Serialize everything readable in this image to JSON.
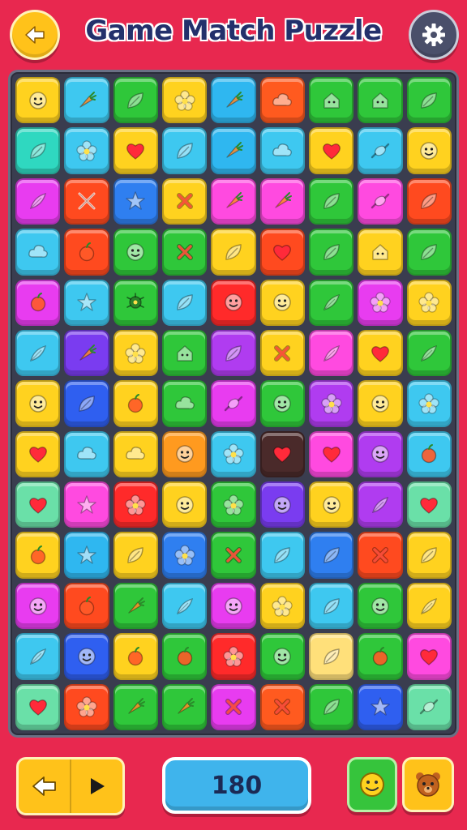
{
  "header": {
    "title": "Game Match Puzzle",
    "back_icon": "arrow-left-icon",
    "settings_icon": "gear-icon"
  },
  "board": {
    "rows": 13,
    "cols": 9,
    "tiles": [
      [
        "#ffd21f",
        "#3ec8f0",
        "#2fc73a",
        "#ffd21f",
        "#2fb7f0",
        "#ff5a1f",
        "#2fc73a",
        "#2fc73a",
        "#2fc73a"
      ],
      [
        "#2fd8c0",
        "#3ec8f0",
        "#ffd21f",
        "#3ec8f0",
        "#2fb7f0",
        "#3ec8f0",
        "#ffd21f",
        "#3ec8f0",
        "#ffd21f"
      ],
      [
        "#e83cf0",
        "#ff4a1f",
        "#2f7ff0",
        "#ffd21f",
        "#ff4ae0",
        "#ff4ae0",
        "#2fc73a",
        "#ff4ae0",
        "#ff4a1f"
      ],
      [
        "#3ec8f0",
        "#ff4a1f",
        "#2fc73a",
        "#2fc73a",
        "#ffd21f",
        "#ff4a1f",
        "#2fc73a",
        "#ffd21f",
        "#2fc73a"
      ],
      [
        "#e83cf0",
        "#3ec8f0",
        "#2fc73a",
        "#3ec8f0",
        "#ff2a2a",
        "#ffd21f",
        "#2fc73a",
        "#e83cf0",
        "#ffd21f"
      ],
      [
        "#3ec8f0",
        "#7a3cf0",
        "#ffd21f",
        "#2fc73a",
        "#b03cf0",
        "#ffd21f",
        "#ff4ae0",
        "#ffd21f",
        "#2fc73a"
      ],
      [
        "#ffd21f",
        "#2f5ff0",
        "#ffd21f",
        "#2fc73a",
        "#e83cf0",
        "#2fc73a",
        "#b03cf0",
        "#ffd21f",
        "#3ec8f0"
      ],
      [
        "#ffd21f",
        "#3ec8f0",
        "#ffd21f",
        "#ff9a1f",
        "#3ec8f0",
        "#4a2a2a",
        "#ff4ae0",
        "#b03cf0",
        "#3ec8f0"
      ],
      [
        "#6ae0a8",
        "#ff4ae0",
        "#ff2a2a",
        "#ffd21f",
        "#2fc73a",
        "#7a3cf0",
        "#ffd21f",
        "#b03cf0",
        "#6ae0a8"
      ],
      [
        "#ffd21f",
        "#2fb7f0",
        "#ffd21f",
        "#2f7ff0",
        "#2fc73a",
        "#3ec8f0",
        "#2f7ff0",
        "#ff4a1f",
        "#ffd21f"
      ],
      [
        "#e83cf0",
        "#ff4a1f",
        "#2fc73a",
        "#3ec8f0",
        "#e83cf0",
        "#ffd21f",
        "#3ec8f0",
        "#2fc73a",
        "#ffd21f"
      ],
      [
        "#3ec8f0",
        "#2f5ff0",
        "#ffd21f",
        "#2fc73a",
        "#ff2a2a",
        "#2fc73a",
        "#ffe07a",
        "#2fc73a",
        "#ff4ae0"
      ],
      [
        "#6ae0a8",
        "#ff4a1f",
        "#2fc73a",
        "#2fc73a",
        "#e83cf0",
        "#ff5a1f",
        "#2fc73a",
        "#2f5ff0",
        "#6ae0a8"
      ]
    ],
    "icons": [
      [
        "face-icon",
        "carrot-icon",
        "leaf-icon",
        "flower-icon",
        "carrot-icon",
        "cloud-icon",
        "house-icon",
        "house-icon",
        "leaf-icon"
      ],
      [
        "leaf-icon",
        "flower-icon",
        "heart-icon",
        "leaf-icon",
        "carrot-icon",
        "cloud-icon",
        "heart-icon",
        "candy-icon",
        "face-icon"
      ],
      [
        "feather-icon",
        "crossed-icon",
        "star-icon",
        "cross-icon",
        "carrot-icon",
        "carrot-icon",
        "leaf-icon",
        "candy-icon",
        "leaf-icon"
      ],
      [
        "cloud-icon",
        "apple-icon",
        "face-icon",
        "cross-icon",
        "leaf-icon",
        "heart-icon",
        "leaf-icon",
        "house-icon",
        "leaf-icon"
      ],
      [
        "apple-icon",
        "star-icon",
        "bug-icon",
        "leaf-icon",
        "face-icon",
        "face-icon",
        "feather-icon",
        "flower-icon",
        "flower-icon"
      ],
      [
        "feather-icon",
        "carrot-icon",
        "flower-icon",
        "house-icon",
        "leaf-icon",
        "cross-icon",
        "feather-icon",
        "heart-icon",
        "feather-icon"
      ],
      [
        "face-icon",
        "leaf-icon",
        "apple-icon",
        "cloud-icon",
        "candy-icon",
        "face-icon",
        "flower-icon",
        "face-icon",
        "flower-icon"
      ],
      [
        "heart-icon",
        "cloud-icon",
        "cloud-icon",
        "face-icon",
        "flower-icon",
        "heart-icon",
        "heart-icon",
        "face-icon",
        "apple-icon"
      ],
      [
        "heart-icon",
        "star-icon",
        "flower-icon",
        "face-icon",
        "flower-icon",
        "face-icon",
        "face-icon",
        "feather-icon",
        "heart-icon"
      ],
      [
        "apple-icon",
        "star-icon",
        "leaf-icon",
        "flower-icon",
        "cross-icon",
        "leaf-icon",
        "leaf-icon",
        "cross-icon",
        "leaf-icon"
      ],
      [
        "face-icon",
        "apple-icon",
        "carrot-icon",
        "feather-icon",
        "face-icon",
        "flower-icon",
        "leaf-icon",
        "face-icon",
        "feather-icon"
      ],
      [
        "feather-icon",
        "face-icon",
        "apple-icon",
        "apple-icon",
        "flower-icon",
        "face-icon",
        "leaf-icon",
        "apple-icon",
        "heart-icon"
      ],
      [
        "heart-icon",
        "flower-icon",
        "carrot-icon",
        "carrot-icon",
        "cross-icon",
        "cross-icon",
        "leaf-icon",
        "star-icon",
        "candy-icon"
      ]
    ]
  },
  "footer": {
    "undo_icon": "arrow-left-icon",
    "play_icon": "play-icon",
    "score": "180",
    "hint_icon": "smiley-icon",
    "shuffle_icon": "bear-icon"
  }
}
